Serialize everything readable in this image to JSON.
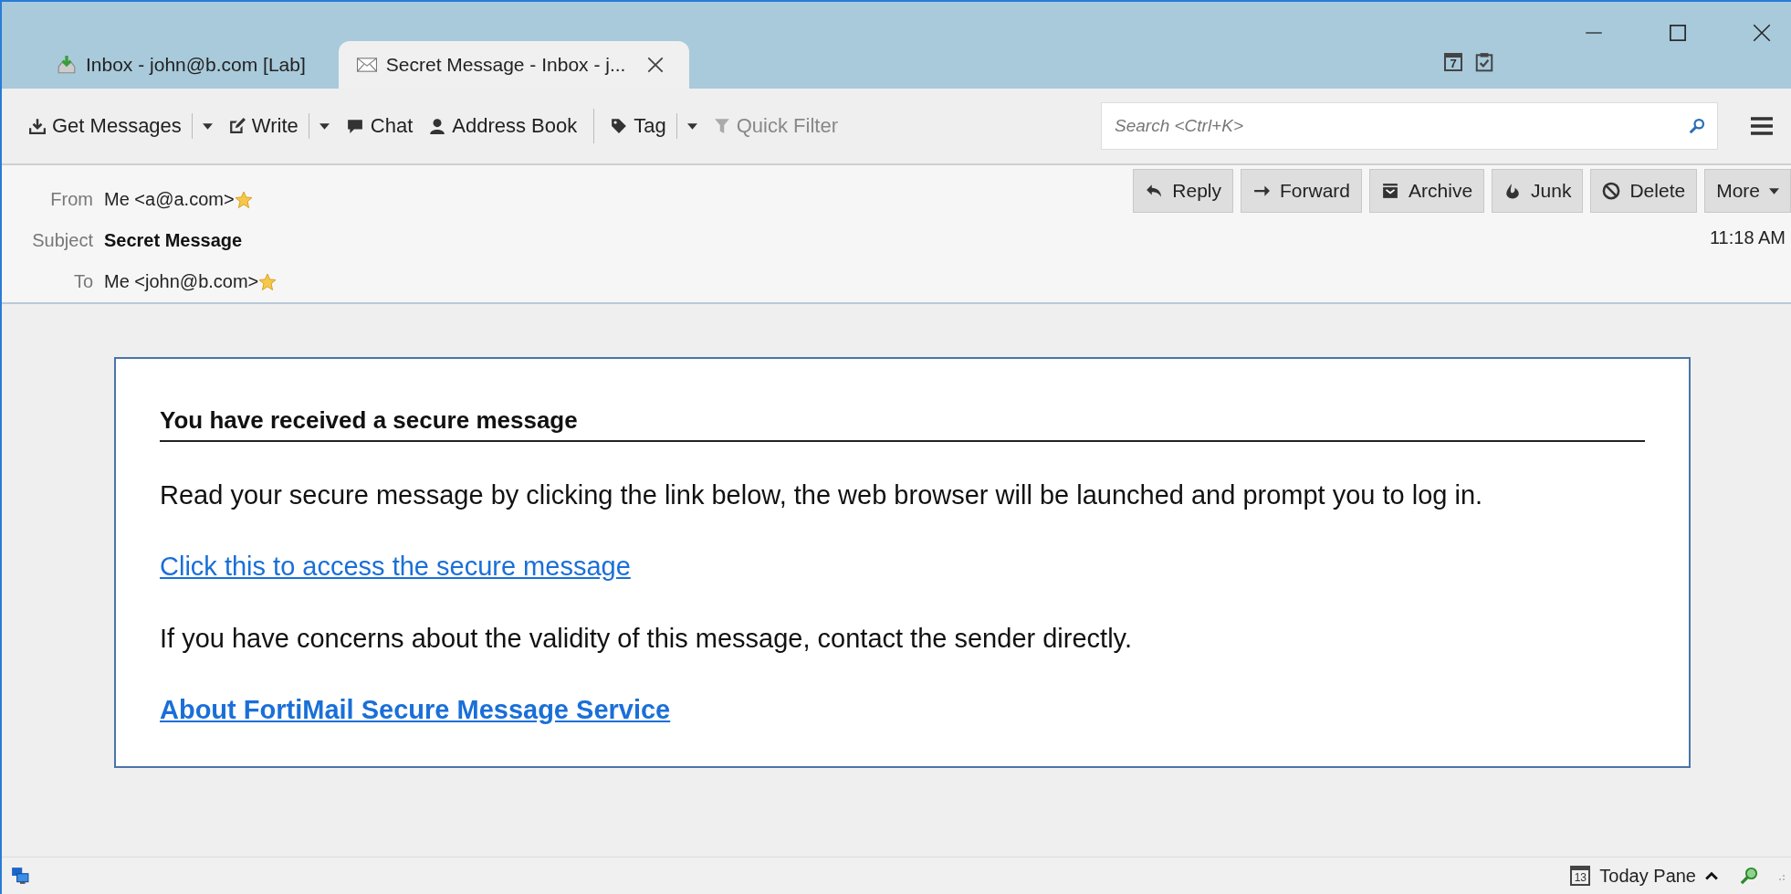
{
  "tabs": [
    {
      "label": "Inbox - john@b.com [Lab]",
      "kind": "inbox",
      "selected": false,
      "closable": false
    },
    {
      "label": "Secret Message - Inbox - j...",
      "kind": "message",
      "selected": true,
      "closable": true
    }
  ],
  "titlebar_icons": [
    {
      "kind": "calendar",
      "text": "7"
    },
    {
      "kind": "tasks"
    }
  ],
  "toolbar": [
    {
      "label": "Get Messages",
      "kind": "download",
      "dropdown": true,
      "disabled": false,
      "separator_after": false
    },
    {
      "label": "Write",
      "kind": "pencil",
      "dropdown": true,
      "disabled": false,
      "separator_after": false
    },
    {
      "label": "Chat",
      "kind": "bubble",
      "dropdown": false,
      "disabled": false,
      "separator_after": false
    },
    {
      "label": "Address Book",
      "kind": "person",
      "dropdown": false,
      "disabled": false,
      "separator_after": true
    },
    {
      "label": "Tag",
      "kind": "tag",
      "dropdown": true,
      "disabled": false,
      "separator_after": false
    },
    {
      "label": "Quick Filter",
      "kind": "funnel",
      "dropdown": false,
      "disabled": true,
      "separator_after": false
    }
  ],
  "search": {
    "placeholder": "Search <Ctrl+K>"
  },
  "header": {
    "fields": [
      {
        "label": "From",
        "value": "Me <a@a.com>",
        "starred": true,
        "bold": false
      },
      {
        "label": "Subject",
        "value": "Secret Message",
        "starred": false,
        "bold": true
      },
      {
        "label": "To",
        "value": "Me <john@b.com>",
        "starred": true,
        "bold": false
      }
    ],
    "actions": [
      {
        "label": "Reply",
        "kind": "reply"
      },
      {
        "label": "Forward",
        "kind": "forward"
      },
      {
        "label": "Archive",
        "kind": "archive"
      },
      {
        "label": "Junk",
        "kind": "junk"
      },
      {
        "label": "Delete",
        "kind": "delete"
      },
      {
        "label": "More",
        "kind": "more"
      }
    ],
    "time": "11:18 AM"
  },
  "message": {
    "heading": "You have received a secure message",
    "blocks": [
      {
        "kind": "text",
        "text": "Read your secure message by clicking the link below, the web browser will be launched and prompt you to log in."
      },
      {
        "kind": "link",
        "text": "Click this to access the secure message"
      },
      {
        "kind": "text",
        "text": "If you have concerns about the validity of this message, contact the sender directly."
      },
      {
        "kind": "boldlink",
        "text": "About FortiMail Secure Message Service"
      }
    ]
  },
  "status_bar": {
    "today_pane": {
      "label": "Today Pane",
      "icon_text": "13",
      "expanded": false
    }
  }
}
